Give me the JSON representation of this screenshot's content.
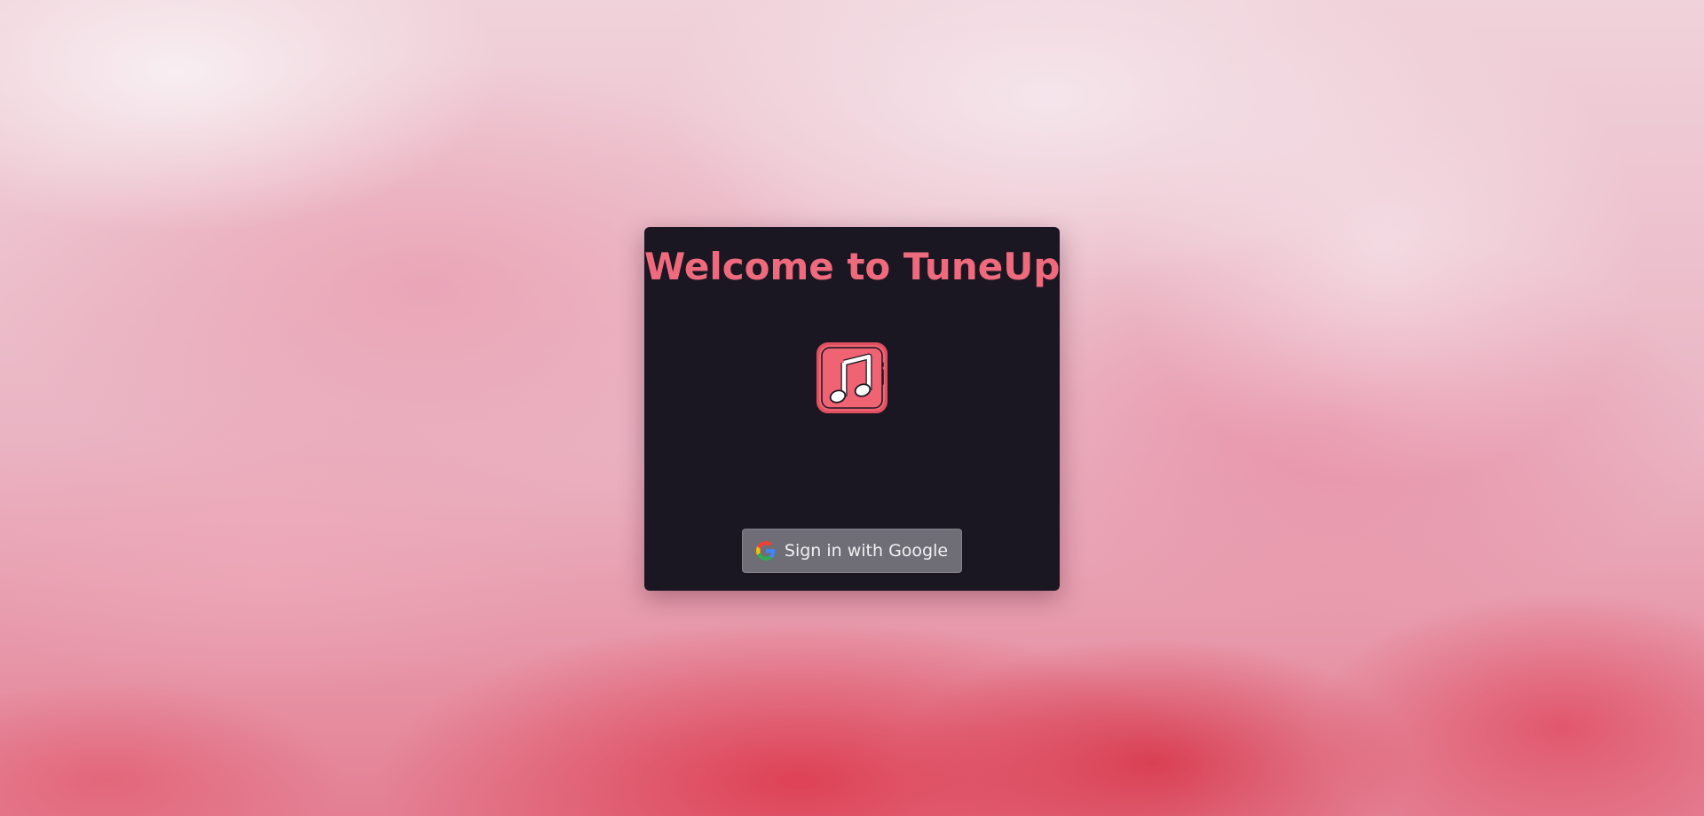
{
  "page": {
    "title": "Welcome to TuneUp"
  },
  "login": {
    "logo_icon": "music-note-icon",
    "google_icon": "google-icon",
    "google_button_label": "Sign in with Google"
  },
  "colors": {
    "accent": "#f06a7d",
    "card_background": "#1a1722",
    "button_background": "#6f6d75"
  }
}
